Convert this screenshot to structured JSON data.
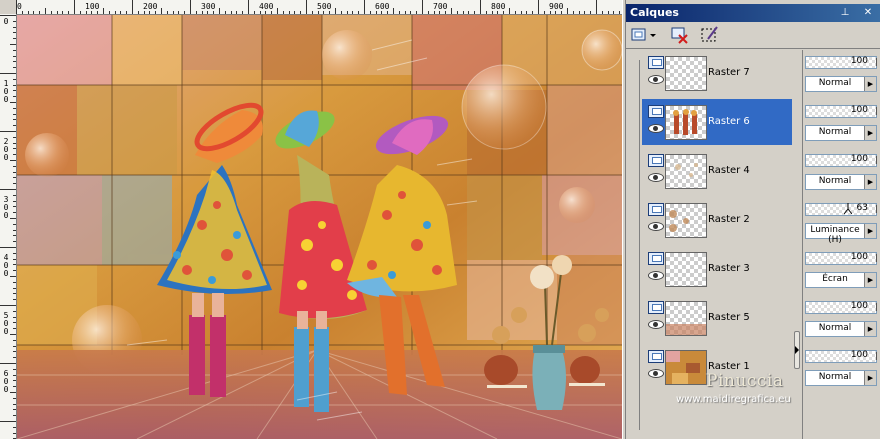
{
  "canvas": {
    "ruler_top_labels": [
      "0",
      "100",
      "200",
      "300",
      "400",
      "500",
      "600",
      "700",
      "800",
      "900"
    ],
    "ruler_left_labels": [
      "0",
      "100",
      "200",
      "300",
      "400",
      "500",
      "600"
    ]
  },
  "panel": {
    "title": "Calques",
    "layers": [
      {
        "name": "Raster 7",
        "opacity": "100",
        "blend": "Normal",
        "selected": false
      },
      {
        "name": "Raster 6",
        "opacity": "100",
        "blend": "Normal",
        "selected": true
      },
      {
        "name": "Raster 4",
        "opacity": "100",
        "blend": "Normal",
        "selected": false
      },
      {
        "name": "Raster 2",
        "opacity": "63",
        "blend": "Luminance (H)",
        "selected": false
      },
      {
        "name": "Raster 3",
        "opacity": "100",
        "blend": "Écran",
        "selected": false
      },
      {
        "name": "Raster 5",
        "opacity": "100",
        "blend": "Normal",
        "selected": false
      },
      {
        "name": "Raster 1",
        "opacity": "100",
        "blend": "Normal",
        "selected": false
      }
    ]
  },
  "watermark": {
    "name": "Pinuccia",
    "url": "www.maidiregrafica.eu"
  }
}
